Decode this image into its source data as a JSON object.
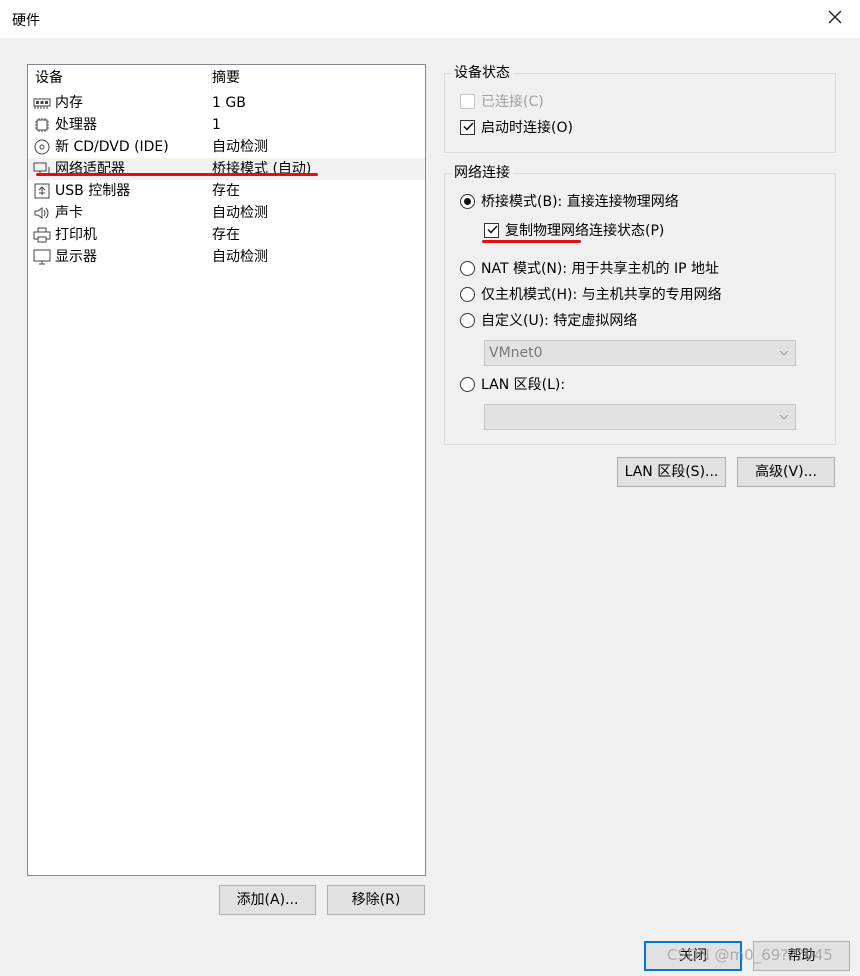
{
  "window": {
    "title": "硬件",
    "close_icon": "close-icon"
  },
  "device_list": {
    "columns": {
      "device": "设备",
      "summary": "摘要"
    },
    "rows": [
      {
        "name": "内存",
        "summary": "1 GB",
        "icon": "memory-icon"
      },
      {
        "name": "处理器",
        "summary": "1",
        "icon": "processor-icon"
      },
      {
        "name": "新 CD/DVD (IDE)",
        "summary": "自动检测",
        "icon": "cd-dvd-icon"
      },
      {
        "name": "网络适配器",
        "summary": "桥接模式 (自动)",
        "icon": "network-adapter-icon",
        "selected": true
      },
      {
        "name": "USB 控制器",
        "summary": "存在",
        "icon": "usb-icon"
      },
      {
        "name": "声卡",
        "summary": "自动检测",
        "icon": "sound-card-icon"
      },
      {
        "name": "打印机",
        "summary": "存在",
        "icon": "printer-icon"
      },
      {
        "name": "显示器",
        "summary": "自动检测",
        "icon": "display-icon"
      }
    ],
    "annotation_color": "#e01010"
  },
  "list_buttons": {
    "add": "添加(A)...",
    "remove": "移除(R)"
  },
  "device_status": {
    "title": "设备状态",
    "connected": {
      "label": "已连接(C)",
      "checked": false,
      "enabled": false
    },
    "connect_at_power_on": {
      "label": "启动时连接(O)",
      "checked": true,
      "enabled": true
    }
  },
  "network_connection": {
    "title": "网络连接",
    "bridged": {
      "label": "桥接模式(B): 直接连接物理网络",
      "selected": true
    },
    "replicate": {
      "label": "复制物理网络连接状态(P)",
      "checked": true
    },
    "nat": {
      "label": "NAT 模式(N): 用于共享主机的 IP 地址",
      "selected": false
    },
    "host_only": {
      "label": "仅主机模式(H): 与主机共享的专用网络",
      "selected": false
    },
    "custom": {
      "label": "自定义(U): 特定虚拟网络",
      "selected": false
    },
    "custom_select": {
      "value": "VMnet0"
    },
    "lan_segment": {
      "label": "LAN 区段(L):",
      "selected": false
    },
    "lan_select": {
      "value": ""
    }
  },
  "right_buttons": {
    "lan_segments": "LAN 区段(S)...",
    "advanced": "高级(V)..."
  },
  "footer": {
    "close": "关闭",
    "help": "帮助"
  },
  "watermark": "CSDN @m0_69???945",
  "colors": {
    "background": "#f0f0f0",
    "focus_border": "#0078d7",
    "selected_row": "#f2f2f2"
  }
}
